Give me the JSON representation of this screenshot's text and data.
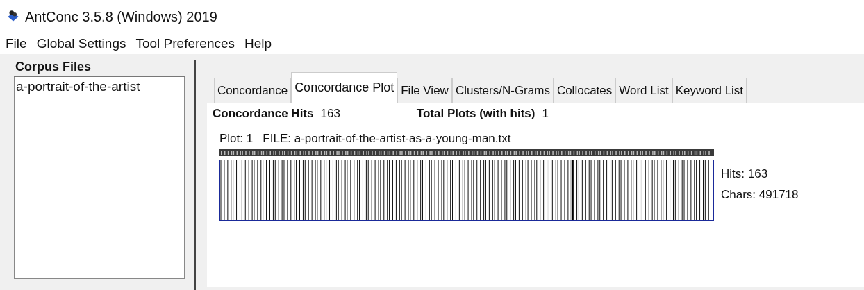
{
  "window": {
    "title": "AntConc 3.5.8 (Windows) 2019"
  },
  "menu": [
    "File",
    "Global Settings",
    "Tool Preferences",
    "Help"
  ],
  "sidebar": {
    "title": "Corpus Files",
    "items": [
      {
        "label": "a-portrait-of-the-artist",
        "selected": false
      }
    ]
  },
  "tabs": [
    {
      "label": "Concordance",
      "selected": false
    },
    {
      "label": "Concordance Plot",
      "selected": true
    },
    {
      "label": "File View",
      "selected": false
    },
    {
      "label": "Clusters/N-Grams",
      "selected": false
    },
    {
      "label": "Collocates",
      "selected": false
    },
    {
      "label": "Word List",
      "selected": false
    },
    {
      "label": "Keyword List",
      "selected": false
    }
  ],
  "summary": {
    "hits_label": "Concordance Hits",
    "hits_value": "163",
    "plots_label": "Total Plots (with hits)",
    "plots_value": "1"
  },
  "plot": {
    "header": "Plot: 1   FILE: a-portrait-of-the-artist-as-a-young-man.txt",
    "hits": "Hits: 163",
    "chars": "Chars: 491718"
  }
}
